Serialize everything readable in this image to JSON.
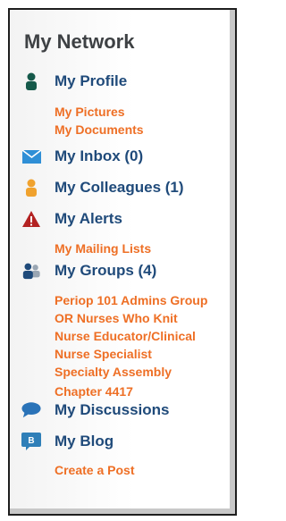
{
  "header": {
    "title": "My Network"
  },
  "nav": {
    "profile": {
      "label": "My Profile",
      "icon": "person-icon",
      "color": "#15594a"
    },
    "pictures": {
      "label": "My Pictures"
    },
    "documents": {
      "label": "My Documents"
    },
    "inbox": {
      "label": "My Inbox (0)",
      "icon": "envelope-icon",
      "color": "#2f8fd6"
    },
    "colleagues": {
      "label": "My Colleagues (1)",
      "icon": "person-icon",
      "color": "#f0a22e"
    },
    "alerts": {
      "label": "My Alerts",
      "icon": "alert-triangle-icon",
      "color": "#b32222"
    },
    "mailing_lists": {
      "label": "My Mailing Lists"
    },
    "groups": {
      "label": "My Groups (4)",
      "icon": "group-icon",
      "color": "#1f4a7a"
    },
    "group_items": [
      "Periop 101 Admins Group",
      "OR Nurses Who Knit",
      "Nurse Educator/Clinical",
      "Nurse Specialist",
      "Specialty Assembly",
      "Chapter 4417"
    ],
    "discussions": {
      "label": "My Discussions",
      "icon": "speech-bubble-icon",
      "color": "#2a73b8"
    },
    "blog": {
      "label": "My Blog",
      "icon": "blog-icon",
      "color": "#2f7fb8"
    },
    "create_post": {
      "label": "Create a Post"
    }
  }
}
